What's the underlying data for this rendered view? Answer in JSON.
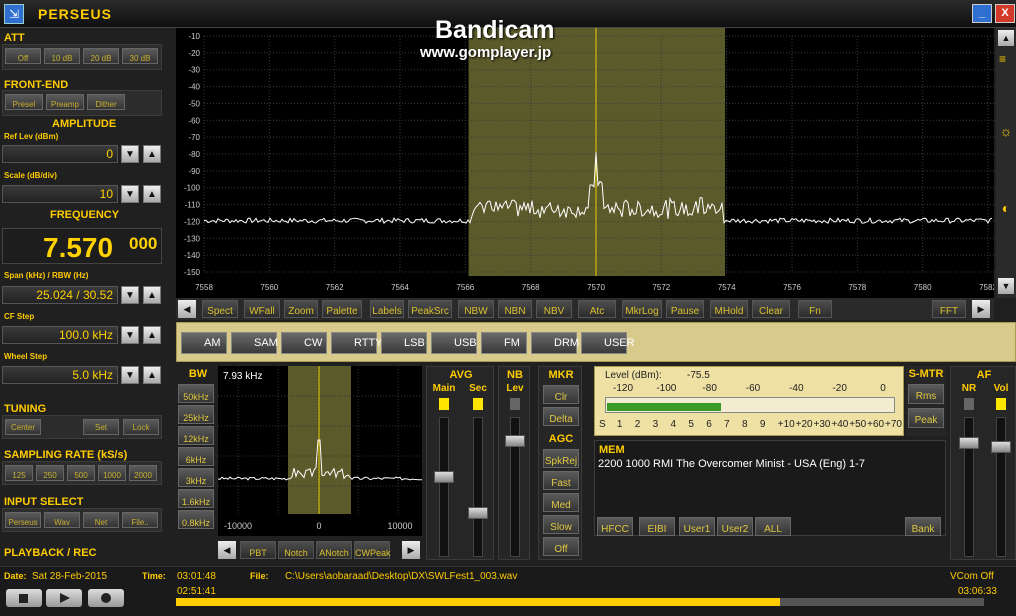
{
  "window": {
    "title": "PERSEUS",
    "icon": "app-icon",
    "min_label": "_",
    "close_label": "X"
  },
  "watermark": {
    "line1": "Bandicam",
    "line2": "www.gomplayer.jp"
  },
  "left": {
    "att": {
      "title": "ATT",
      "buttons": [
        {
          "label": "Off",
          "on": true
        },
        {
          "label": "10 dB",
          "on": false
        },
        {
          "label": "20 dB",
          "on": false
        },
        {
          "label": "30 dB",
          "on": false
        }
      ]
    },
    "frontend": {
      "title": "FRONT-END",
      "buttons": [
        {
          "label": "Presel",
          "on": true
        },
        {
          "label": "Preamp",
          "on": true
        },
        {
          "label": "Dither",
          "on": true
        }
      ]
    },
    "amplitude": {
      "title": "AMPLITUDE",
      "ref_label": "Ref Lev (dBm)",
      "ref_value": "0",
      "scale_label": "Scale (dB/div)",
      "scale_value": "10"
    },
    "frequency": {
      "title": "FREQUENCY",
      "main": "7.570",
      "sub": "000",
      "span_label": "Span (kHz) / RBW (Hz)",
      "span_value": "25.024 / 30.52",
      "cf_label": "CF Step",
      "cf_value": "100.0 kHz",
      "wheel_label": "Wheel Step",
      "wheel_value": "5.0 kHz"
    },
    "tuning": {
      "title": "TUNING",
      "buttons": [
        {
          "label": "Center"
        },
        {
          "label": "Set"
        },
        {
          "label": "Lock"
        }
      ]
    },
    "sampling": {
      "title": "SAMPLING RATE (kS/s)",
      "buttons": [
        {
          "label": "125",
          "on": true
        },
        {
          "label": "250",
          "on": false
        },
        {
          "label": "500",
          "on": false
        },
        {
          "label": "1000",
          "on": false
        },
        {
          "label": "2000",
          "on": false
        }
      ]
    },
    "input": {
      "title": "INPUT SELECT",
      "buttons": [
        {
          "label": "Perseus",
          "on": true
        },
        {
          "label": "Wav",
          "on": true
        },
        {
          "label": "Net",
          "on": false
        },
        {
          "label": "File..",
          "on": false
        }
      ]
    },
    "playback": {
      "title": "PLAYBACK / REC"
    }
  },
  "spectrum": {
    "y_ticks": [
      "-10",
      "-20",
      "-30",
      "-40",
      "-50",
      "-60",
      "-70",
      "-80",
      "-90",
      "-100",
      "-110",
      "-120",
      "-130",
      "-140",
      "-150"
    ],
    "x_ticks": [
      "7558",
      "7560",
      "7562",
      "7564",
      "7566",
      "7568",
      "7570",
      "7572",
      "7574",
      "7576",
      "7578",
      "7580",
      "7582"
    ],
    "toolbar": [
      {
        "label": "Spect",
        "on": true
      },
      {
        "label": "WFall",
        "on": true
      },
      {
        "label": "Zoom",
        "on": true
      },
      {
        "label": "Palette",
        "on": false
      },
      {
        "label": "Labels",
        "on": true
      },
      {
        "label": "PeakSrc",
        "on": false
      },
      {
        "label": "NBW",
        "on": true
      },
      {
        "label": "NBN",
        "on": false
      },
      {
        "label": "NBV",
        "on": false
      },
      {
        "label": "Atc",
        "on": false
      },
      {
        "label": "MkrLog",
        "on": false
      },
      {
        "label": "Pause",
        "on": false
      },
      {
        "label": "MHold",
        "on": false
      },
      {
        "label": "Clear",
        "on": false
      },
      {
        "label": "Fn",
        "on": false
      },
      {
        "label": "FFT",
        "on": true
      }
    ]
  },
  "modes": [
    {
      "label": "AM",
      "on": true
    },
    {
      "label": "SAM",
      "on": false
    },
    {
      "label": "CW",
      "on": false
    },
    {
      "label": "RTTY",
      "on": false
    },
    {
      "label": "LSB",
      "on": false
    },
    {
      "label": "USB",
      "on": false
    },
    {
      "label": "FM",
      "on": false
    },
    {
      "label": "DRM",
      "on": false
    },
    {
      "label": "USER",
      "on": false
    }
  ],
  "bw": {
    "title": "BW",
    "buttons": [
      "50kHz",
      "25kHz",
      "12kHz",
      "6kHz",
      "3kHz",
      "1.6kHz",
      "0.8kHz"
    ],
    "readout": "7.93 kHz",
    "x_ticks": [
      "-10000",
      "0",
      "10000"
    ],
    "filters": [
      {
        "label": "PBT"
      },
      {
        "label": "Notch"
      },
      {
        "label": "ANotch"
      },
      {
        "label": "CWPeak"
      }
    ]
  },
  "avg": {
    "title": "AVG",
    "main": "Main",
    "sec": "Sec"
  },
  "nb": {
    "title": "NB",
    "lev": "Lev"
  },
  "mkr": {
    "title": "MKR",
    "buttons": [
      "Clr",
      "Delta"
    ]
  },
  "agc": {
    "title": "AGC",
    "buttons": [
      "SpkRej",
      "Fast",
      "Med",
      "Slow",
      "Off"
    ]
  },
  "level": {
    "label": "Level (dBm):",
    "value": "-75.5",
    "top_scale": [
      "-120",
      "-100",
      "-80",
      "-60",
      "-40",
      "-20",
      "0"
    ],
    "s_scale": [
      "S",
      "1",
      "2",
      "3",
      "4",
      "5",
      "6",
      "7",
      "8",
      "9",
      "+10",
      "+20",
      "+30",
      "+40",
      "+50",
      "+60",
      "+70"
    ],
    "meter_fraction": 0.4
  },
  "smtr": {
    "title": "S-MTR",
    "buttons": [
      "Rms",
      "Peak"
    ]
  },
  "af": {
    "title": "AF",
    "nr": "NR",
    "vol": "Vol"
  },
  "mem": {
    "title": "MEM",
    "entry": "2200 1000 RMI The Overcomer Minist - USA (Eng)   1-7",
    "buttons": [
      {
        "label": "HFCC"
      },
      {
        "label": "EIBI"
      },
      {
        "label": "User1"
      },
      {
        "label": "User2"
      },
      {
        "label": "ALL"
      },
      {
        "label": "Bank"
      }
    ]
  },
  "status": {
    "date_label": "Date:",
    "date": "Sat 28-Feb-2015",
    "time_label": "Time:",
    "time": "03:01:48",
    "file_label": "File:",
    "file": "C:\\Users\\aobaraad\\Desktop\\DX\\SWLFest1_003.wav",
    "vcom": "VCom Off",
    "elapsed": "02:51:41",
    "total": "03:06:33",
    "progress_fraction": 0.747
  },
  "colors": {
    "accent": "#ffcc00",
    "passband": "#5a5a2a",
    "trace": "#ffffff",
    "marker": "#e8d000"
  }
}
